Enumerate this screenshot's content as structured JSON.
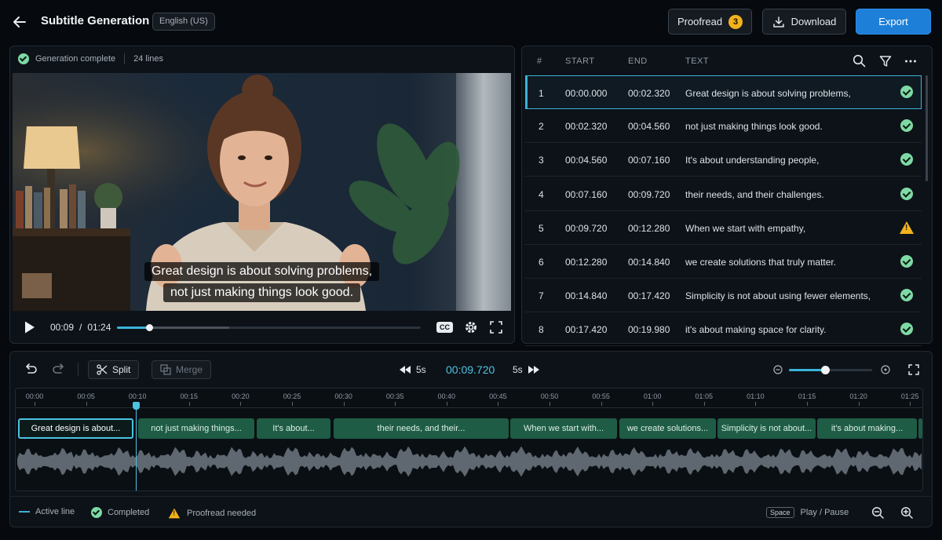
{
  "header": {
    "title": "Subtitle Generation",
    "language": "English (US)",
    "proofread_label": "Proofread",
    "proofread_count": "3",
    "download_label": "Download",
    "export_label": "Export"
  },
  "status": {
    "text": "Generation complete",
    "lines": "24 lines"
  },
  "video": {
    "caption_line1": "Great design is about solving problems,",
    "caption_line2": "not just making things look good.",
    "current_time": "00:09",
    "time_separator": "/",
    "duration": "01:24",
    "progress_fraction": 0.107,
    "buffered_fraction": 0.37,
    "cc_label": "CC"
  },
  "table": {
    "headers": {
      "num": "#",
      "start": "START",
      "end": "END",
      "text": "TEXT"
    },
    "rows": [
      {
        "num": "1",
        "start": "00:00.000",
        "end": "00:02.320",
        "text": "Great design is about solving problems,",
        "status": "completed"
      },
      {
        "num": "2",
        "start": "00:02.320",
        "end": "00:04.560",
        "text": "not just making things look good.",
        "status": "completed"
      },
      {
        "num": "3",
        "start": "00:04.560",
        "end": "00:07.160",
        "text": "It's about understanding people,",
        "status": "completed"
      },
      {
        "num": "4",
        "start": "00:07.160",
        "end": "00:09.720",
        "text": "their needs, and their challenges.",
        "status": "completed"
      },
      {
        "num": "5",
        "start": "00:09.720",
        "end": "00:12.280",
        "text": "When we start with empathy,",
        "status": "proofread"
      },
      {
        "num": "6",
        "start": "00:12.280",
        "end": "00:14.840",
        "text": "we create solutions that truly matter.",
        "status": "completed"
      },
      {
        "num": "7",
        "start": "00:14.840",
        "end": "00:17.420",
        "text": "Simplicity is not about using fewer elements,",
        "status": "completed"
      },
      {
        "num": "8",
        "start": "00:17.420",
        "end": "00:19.980",
        "text": "it's about making space for clarity.",
        "status": "completed"
      }
    ]
  },
  "timeline": {
    "split_label": "Split",
    "merge_label": "Merge",
    "skip_back_label": "5s",
    "skip_forward_label": "5s",
    "current_time": "00:09.720",
    "zoom_fraction": 0.43,
    "ticks": [
      "00:00",
      "00:05",
      "00:10",
      "00:15",
      "00:20",
      "00:25",
      "00:30",
      "00:35",
      "00:40",
      "00:45",
      "00:50",
      "00:55",
      "01:00",
      "01:05",
      "01:10",
      "01:15",
      "01:20",
      "01:25"
    ],
    "segments": [
      "Great design is about...",
      "not just making things...",
      "It's about...",
      "their needs, and their...",
      "When we start with...",
      "we create solutions...",
      "Simplicity is not about...",
      "it's about making..."
    ]
  },
  "legend": {
    "active": "Active line",
    "completed": "Completed",
    "proofread": "Proofread needed",
    "shortcut_key": "Space",
    "shortcut_action": "Play / Pause"
  },
  "colors": {
    "accent": "#1d7fd8",
    "active_line": "#3ab3d8",
    "completed": "#7ed9a4",
    "warning": "#f2b21c",
    "segment": "#1f5c45"
  }
}
